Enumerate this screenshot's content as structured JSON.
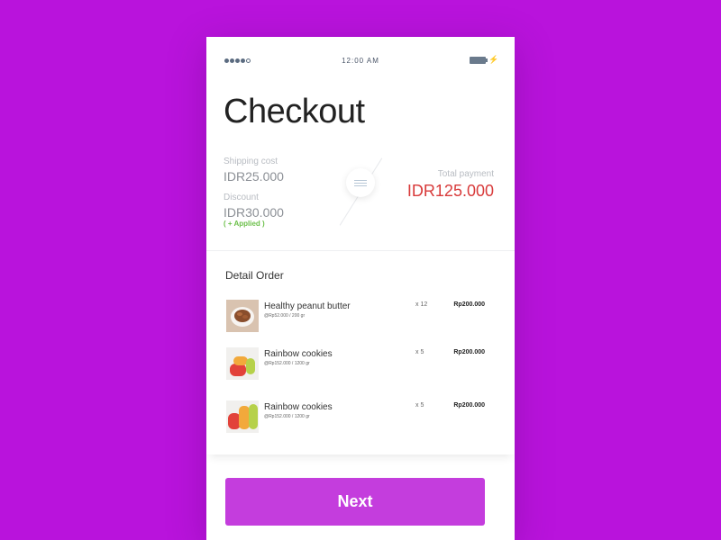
{
  "status_bar": {
    "time": "12:00 AM"
  },
  "page_title": "Checkout",
  "summary": {
    "shipping_label": "Shipping cost",
    "shipping_value": "IDR25.000",
    "discount_label": "Discount",
    "discount_value": "IDR30.000",
    "discount_status": "( + Applied )",
    "total_label": "Total payment",
    "total_value": "IDR125.000"
  },
  "order": {
    "title": "Detail Order",
    "items": [
      {
        "name": "Healthy peanut butter",
        "unit": "@Rp52.000 / 200 gr",
        "qty": "x 12",
        "price": "Rp200.000",
        "icon": "peanut-butter-thumbnail"
      },
      {
        "name": "Rainbow cookies",
        "unit": "@Rp152.000 / 1200 gr",
        "qty": "x 5",
        "price": "Rp200.000",
        "icon": "macaron-thumbnail"
      },
      {
        "name": "Rainbow cookies",
        "unit": "@Rp152.000 / 1200 gr",
        "qty": "x 5",
        "price": "Rp200.000",
        "icon": "macaron-thumbnail"
      }
    ]
  },
  "actions": {
    "next_label": "Next"
  },
  "colors": {
    "background": "#b913dc",
    "total": "#d83a3a",
    "applied": "#6cc04a",
    "button": "#c43ddd"
  }
}
